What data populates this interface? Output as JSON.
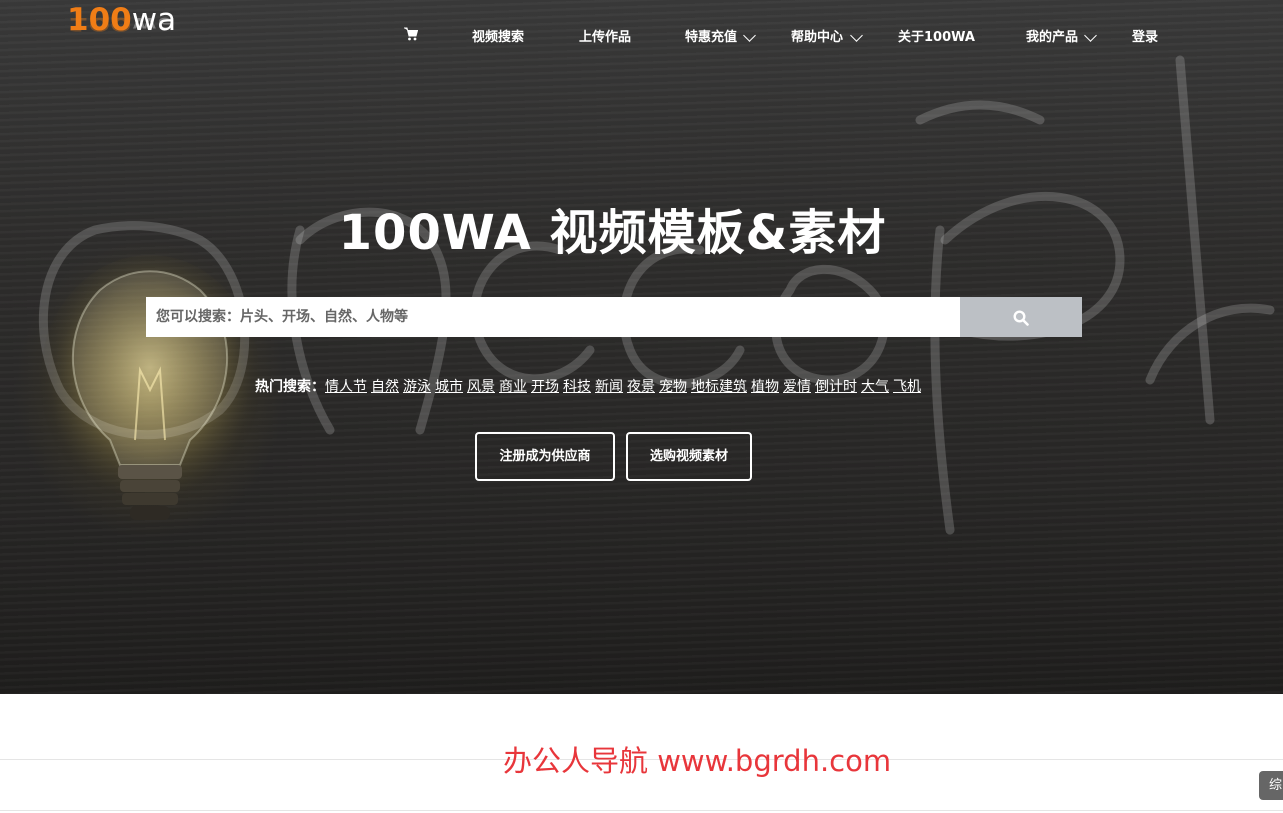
{
  "logo": {
    "number": "100",
    "letters": "wa"
  },
  "nav": {
    "cart_icon": "cart-icon",
    "items": [
      {
        "label": "视频搜索"
      },
      {
        "label": "上传作品"
      },
      {
        "label": "特惠充值"
      },
      {
        "label": "帮助中心"
      },
      {
        "label": "关于100WA"
      },
      {
        "label": "我的产品"
      },
      {
        "label": "登录"
      }
    ]
  },
  "hero": {
    "title": "100WA 视频模板&素材",
    "search_placeholder": "您可以搜索：片头、开场、自然、人物等",
    "search_icon": "search-icon",
    "hot_label": "热门搜索：",
    "hot_tags": [
      "情人节",
      "自然",
      "游泳",
      "城市",
      "风景",
      "商业",
      "开场",
      "科技",
      "新闻",
      "夜景",
      "宠物",
      "地标建筑",
      "植物",
      "爱情",
      "倒计时",
      "大气",
      "飞机"
    ],
    "buttons": {
      "supplier": "注册成为供应商",
      "buy": "选购视频素材"
    }
  },
  "watermark": "办公人导航 www.bgrdh.com",
  "side_tab": "综",
  "colors": {
    "accent_orange": "#f07d16",
    "search_button": "#bcc0c5",
    "watermark": "#e8363b"
  }
}
